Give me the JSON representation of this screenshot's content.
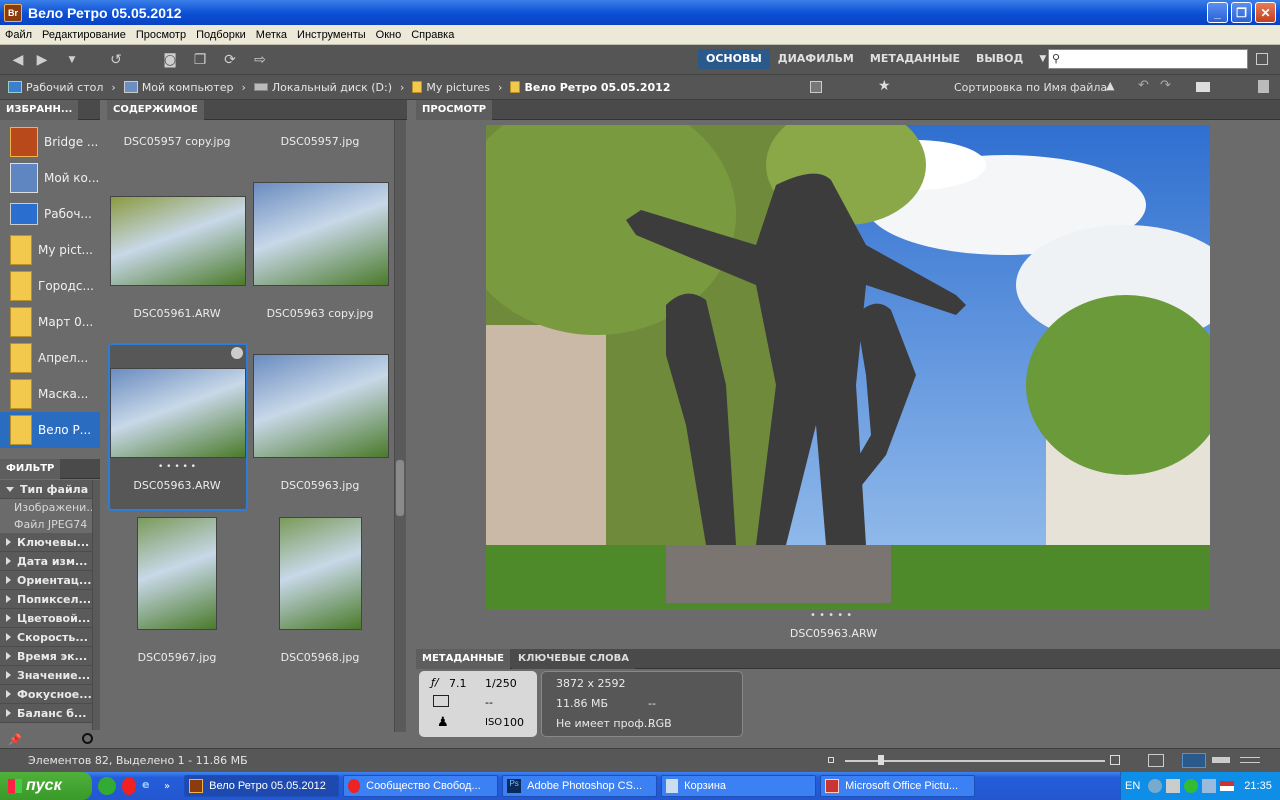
{
  "window": {
    "title": "Вело Ретро 05.05.2012",
    "app_icon": "Br"
  },
  "menu": [
    "Файл",
    "Редактирование",
    "Просмотр",
    "Подборки",
    "Метка",
    "Инструменты",
    "Окно",
    "Справка"
  ],
  "workspaces": {
    "items": [
      "ОСНОВЫ",
      "ДИАФИЛЬМ",
      "МЕТАДАННЫЕ",
      "ВЫВОД"
    ],
    "active": "ОСНОВЫ"
  },
  "search": {
    "placeholder": "",
    "value": ""
  },
  "breadcrumb": [
    {
      "label": "Рабочий стол",
      "icon": "desktop-icon"
    },
    {
      "label": "Мой компьютер",
      "icon": "computer-icon"
    },
    {
      "label": "Локальный диск (D:)",
      "icon": "disk-icon"
    },
    {
      "label": "My pictures",
      "icon": "folder-icon"
    },
    {
      "label": "Вело Ретро 05.05.2012",
      "icon": "folder-icon"
    }
  ],
  "sort_label": "Сортировка по Имя файла",
  "panels": {
    "favorites": "ИЗБРАНН...",
    "content": "СОДЕРЖИМОЕ",
    "preview": "ПРОСМОТР",
    "filter": "ФИЛЬТР",
    "metadata": "МЕТАДАННЫЕ",
    "keywords": "КЛЮЧЕВЫЕ СЛОВА"
  },
  "favorites": [
    {
      "label": "Bridge ...",
      "icon": "bridge-home-icon"
    },
    {
      "label": "Мой ко...",
      "icon": "computer-icon"
    },
    {
      "label": "Рабоч...",
      "icon": "desktop-icon"
    },
    {
      "label": "My pict...",
      "icon": "folder-icon"
    },
    {
      "label": "Городс...",
      "icon": "folder-icon"
    },
    {
      "label": "Март 0...",
      "icon": "folder-icon"
    },
    {
      "label": "Апрел...",
      "icon": "folder-icon"
    },
    {
      "label": "Маска...",
      "icon": "folder-icon"
    },
    {
      "label": "Вело Р...",
      "icon": "folder-icon",
      "selected": true
    }
  ],
  "filter": {
    "groups": [
      {
        "label": "Тип файла",
        "open": true,
        "sub": [
          "Изображени...",
          "Файл JPEG74"
        ]
      },
      {
        "label": "Ключевы..."
      },
      {
        "label": "Дата изм..."
      },
      {
        "label": "Ориентац..."
      },
      {
        "label": "Попиксел..."
      },
      {
        "label": "Цветовой..."
      },
      {
        "label": "Скорость..."
      },
      {
        "label": "Время эк..."
      },
      {
        "label": "Значение..."
      },
      {
        "label": "Фокусное..."
      },
      {
        "label": "Баланс б..."
      }
    ]
  },
  "thumbs": [
    {
      "name": "DSC05957 copy.jpg"
    },
    {
      "name": "DSC05957.jpg"
    },
    {
      "name": "DSC05961.ARW"
    },
    {
      "name": "DSC05963 copy.jpg"
    },
    {
      "name": "DSC05963.ARW",
      "selected": true,
      "rating": "• • • • •"
    },
    {
      "name": "DSC05963.jpg"
    },
    {
      "name": "DSC05967.jpg"
    },
    {
      "name": "DSC05968.jpg"
    }
  ],
  "preview": {
    "caption": "DSC05963.ARW",
    "rating": "• • • • •"
  },
  "metadata": {
    "aperture": "7.1",
    "aperture_prefix": "ƒ/",
    "shutter": "1/250",
    "metering": "--",
    "iso_label": "ISO",
    "iso": "100",
    "dimensions": "3872 x 2592",
    "size": "11.86 МБ",
    "dash": "--",
    "profile": "Не имеет проф...",
    "mode": "RGB"
  },
  "status": "Элементов 82, Выделено 1 - 11.86 МБ",
  "taskbar": {
    "start": "пуск",
    "tasks": [
      {
        "label": "Вело Ретро 05.05.2012",
        "icon": "bridge-icon",
        "active": true
      },
      {
        "label": "Сообщество Свобод...",
        "icon": "opera-icon"
      },
      {
        "label": "Adobe Photoshop CS...",
        "icon": "photoshop-icon"
      },
      {
        "label": "Корзина",
        "icon": "recycle-bin-icon"
      },
      {
        "label": "Microsoft Office Pictu...",
        "icon": "office-picture-icon"
      }
    ],
    "lang": "EN",
    "clock": "21:35"
  },
  "colors": {
    "panel": "#6b6b6b",
    "accent": "#2a5a8c",
    "selection": "#2f7bd8",
    "title": "#0b4fd6"
  }
}
